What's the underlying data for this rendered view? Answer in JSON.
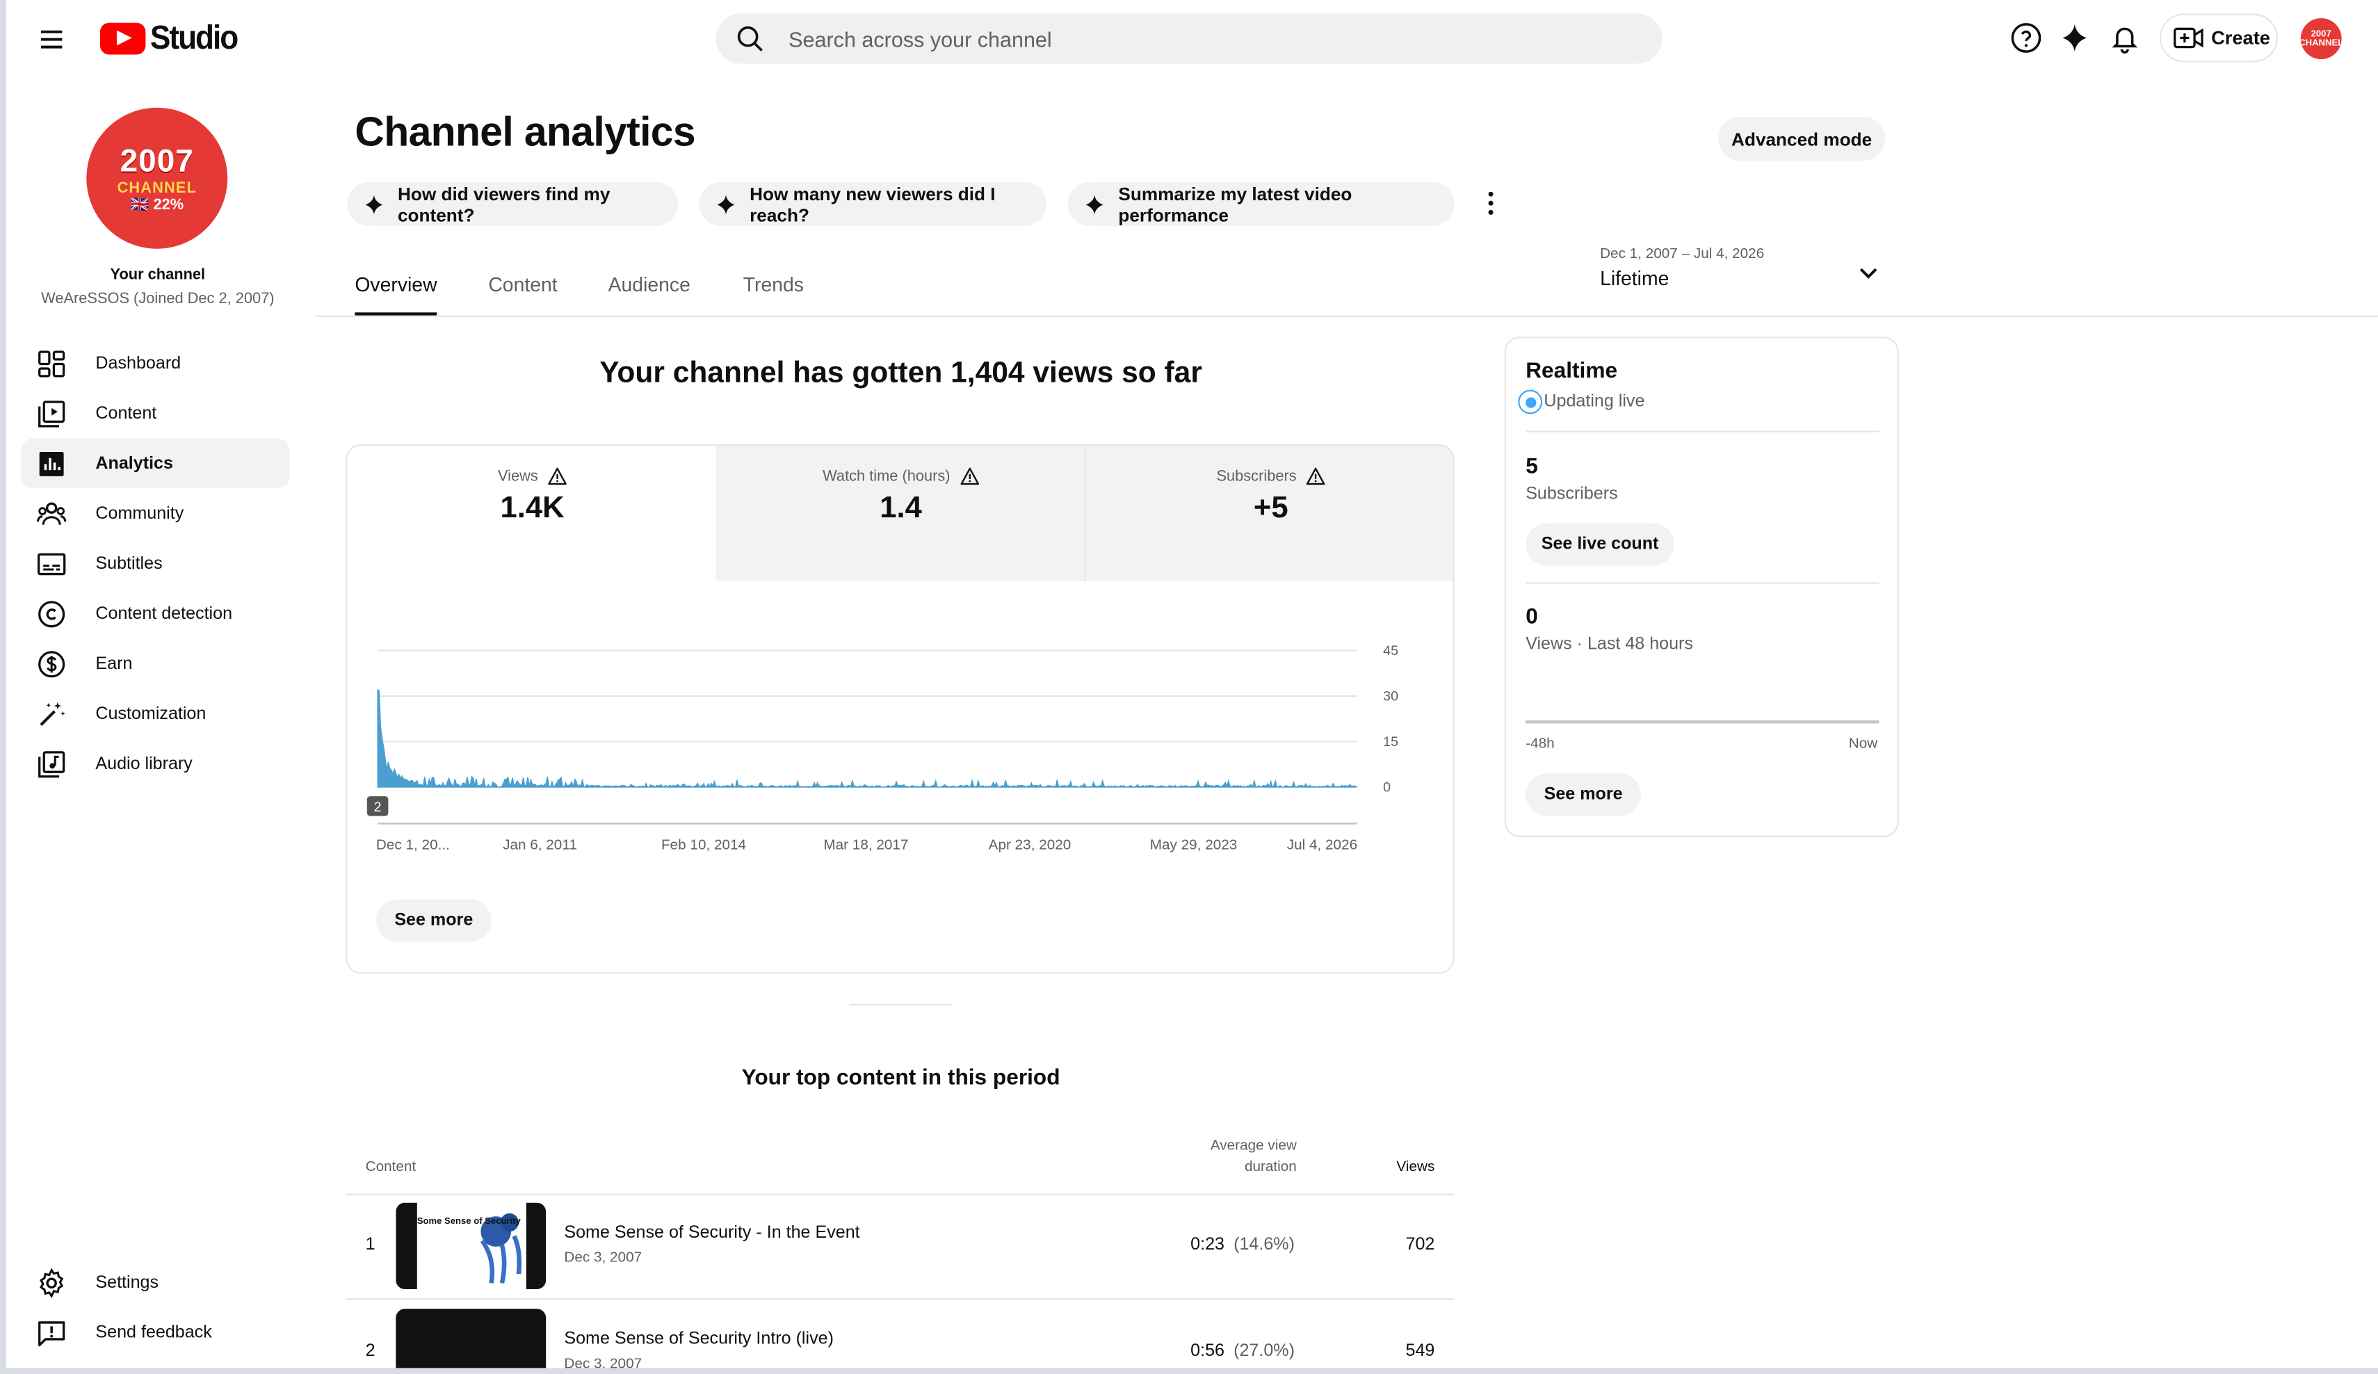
{
  "app": {
    "logo_text": "Studio"
  },
  "search": {
    "placeholder": "Search across your channel"
  },
  "topbar": {
    "create_label": "Create",
    "avatar_text": "2007 CHANNEL"
  },
  "channel": {
    "avatar_line1": "2007",
    "avatar_line2": "CHANNEL",
    "avatar_line3": "🇬🇧 22%",
    "title": "Your channel",
    "subtitle": "WeAreSSOS (Joined Dec 2, 2007)"
  },
  "sidebar": {
    "items": [
      {
        "label": "Dashboard",
        "icon": "dashboard-icon"
      },
      {
        "label": "Content",
        "icon": "content-icon"
      },
      {
        "label": "Analytics",
        "icon": "analytics-icon",
        "active": true
      },
      {
        "label": "Community",
        "icon": "community-icon"
      },
      {
        "label": "Subtitles",
        "icon": "subtitles-icon"
      },
      {
        "label": "Content detection",
        "icon": "copyright-icon"
      },
      {
        "label": "Earn",
        "icon": "dollar-icon"
      },
      {
        "label": "Customization",
        "icon": "magic-wand-icon"
      },
      {
        "label": "Audio library",
        "icon": "audio-library-icon"
      }
    ],
    "bottom": [
      {
        "label": "Settings",
        "icon": "gear-icon"
      },
      {
        "label": "Send feedback",
        "icon": "feedback-icon"
      }
    ]
  },
  "page": {
    "title": "Channel analytics",
    "advanced_mode": "Advanced mode"
  },
  "chips": [
    "How did viewers find my content?",
    "How many new viewers did I reach?",
    "Summarize my latest video performance"
  ],
  "tabs": [
    "Overview",
    "Content",
    "Audience",
    "Trends"
  ],
  "date_range": {
    "range": "Dec 1, 2007 – Jul 4, 2026",
    "label": "Lifetime"
  },
  "overview": {
    "headline": "Your channel has gotten 1,404 views so far",
    "metrics": [
      {
        "label": "Views",
        "value": "1.4K"
      },
      {
        "label": "Watch time (hours)",
        "value": "1.4"
      },
      {
        "label": "Subscribers",
        "value": "+5"
      }
    ],
    "see_more": "See more",
    "marker_label": "2"
  },
  "chart_data": {
    "type": "bar",
    "metric": "Views",
    "x_tick_labels": [
      "Dec 1, 20...",
      "Jan 6, 2011",
      "Feb 10, 2014",
      "Mar 18, 2017",
      "Apr 23, 2020",
      "May 29, 2023",
      "Jul 4, 2026"
    ],
    "y_ticks": [
      "45",
      "30",
      "15",
      "0"
    ],
    "ylim": [
      0,
      45
    ],
    "x_range": [
      "2007-12-01",
      "2026-07-04"
    ],
    "daily_values_note_sample": [
      38,
      36,
      30,
      22,
      16,
      11,
      9,
      8,
      7,
      7,
      6,
      6,
      5,
      5,
      5,
      4,
      4,
      4,
      3,
      3,
      3,
      3,
      2,
      2,
      2,
      2,
      2,
      1,
      1,
      1
    ],
    "grid": true
  },
  "top_content": {
    "title": "Your top content in this period",
    "headers": {
      "content": "Content",
      "avg_line1": "Average view",
      "avg_line2": "duration",
      "views": "Views"
    },
    "rows": [
      {
        "rank": "1",
        "title": "Some Sense of Security - In the Event",
        "date": "Dec 3, 2007",
        "duration": "0:23",
        "pct": "(14.6%)",
        "views": "702",
        "thumb_text": "Some Sense of Security"
      },
      {
        "rank": "2",
        "title": "Some Sense of Security Intro (live)",
        "date": "Dec 3, 2007",
        "duration": "0:56",
        "pct": "(27.0%)",
        "views": "549"
      }
    ]
  },
  "realtime": {
    "title": "Realtime",
    "status": "Updating live",
    "subscribers_value": "5",
    "subscribers_label": "Subscribers",
    "live_count_btn": "See live count",
    "views_value": "0",
    "views_label": "Views · Last 48 hours",
    "axis_start": "-48h",
    "axis_end": "Now",
    "see_more": "See more",
    "views_last_48h_fraction": 0
  },
  "colors": {
    "accent": "#065fd4",
    "chart": "#4a9fd0",
    "live": "#3ea6ff",
    "brand": "#ff0000"
  }
}
